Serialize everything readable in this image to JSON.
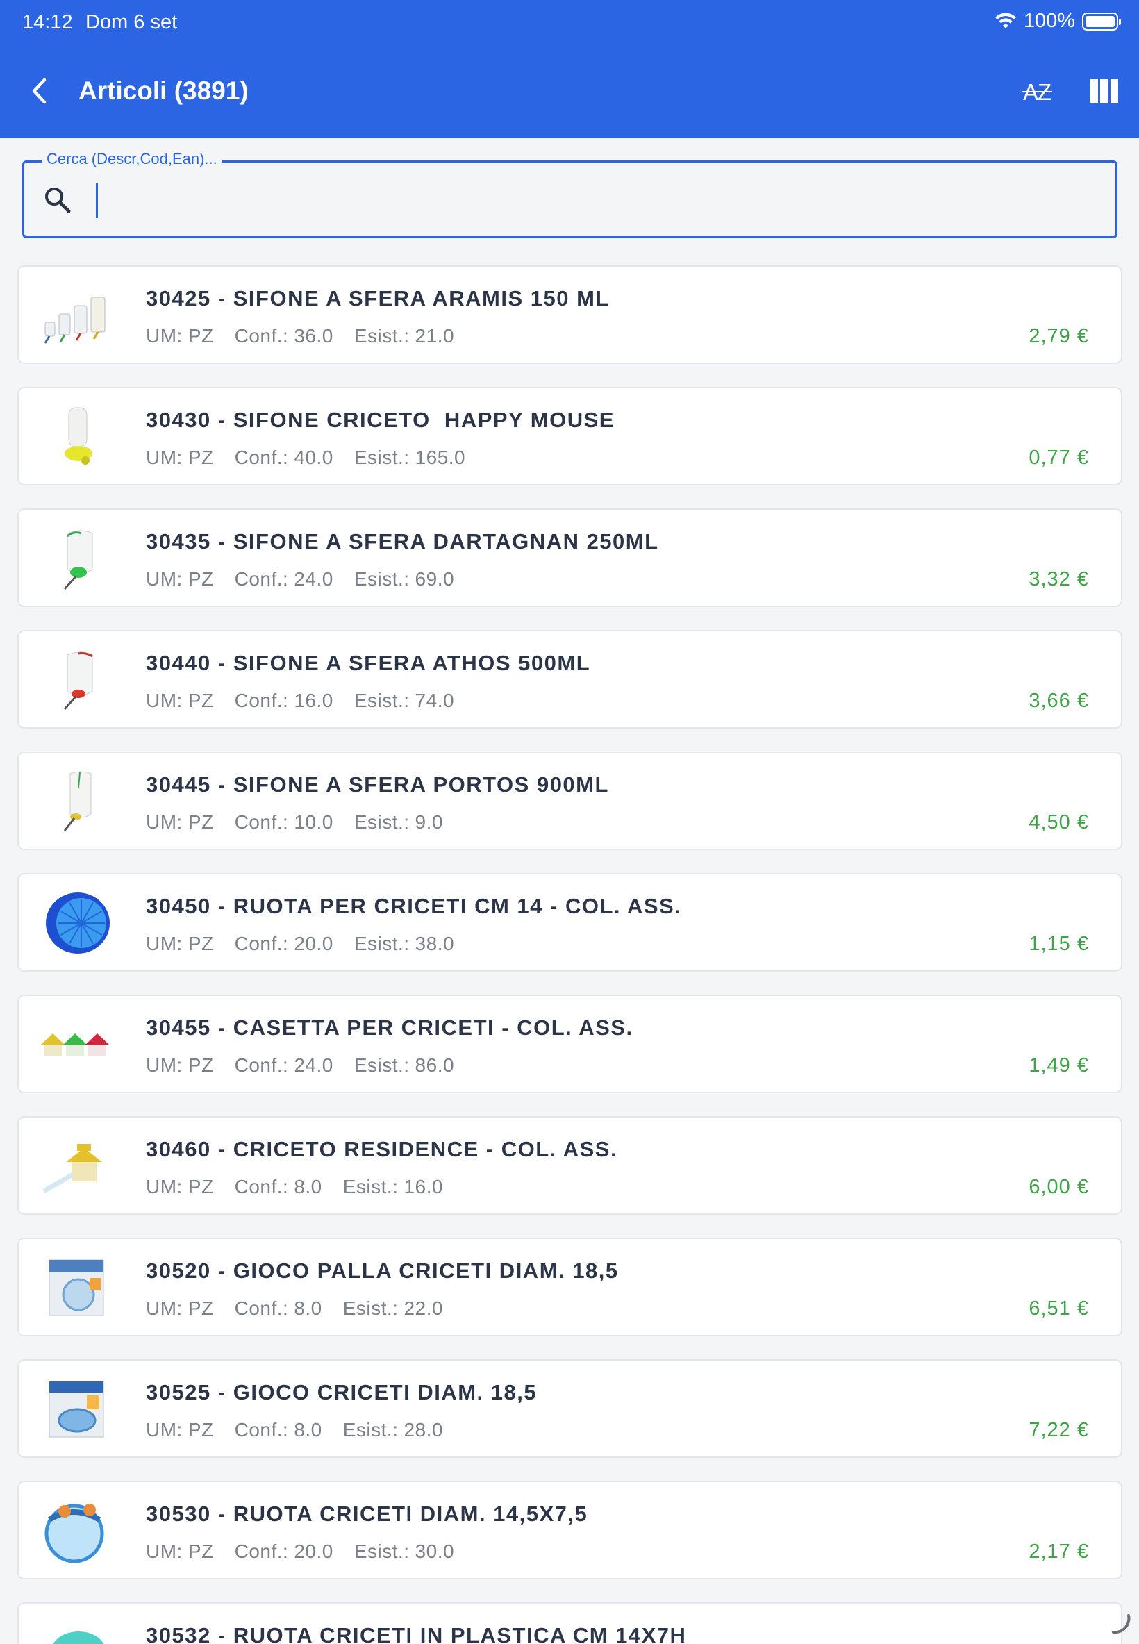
{
  "status": {
    "time": "14:12",
    "date": "Dom 6 set",
    "battery": "100%"
  },
  "header": {
    "title": "Articoli (3891)",
    "sort_label": "AZ"
  },
  "search": {
    "label": "Cerca (Descr,Cod,Ean)...",
    "value": ""
  },
  "meta_labels": {
    "um": "UM:",
    "conf": "Conf.:",
    "esist": "Esist.:"
  },
  "items": [
    {
      "title": "30425 - SIFONE A SFERA ARAMIS 150 ML",
      "um": "PZ",
      "conf": "36.0",
      "esist": "21.0",
      "price": "2,79 €",
      "thumb": "bottles-set-icon"
    },
    {
      "title": "30430 - SIFONE CRICETO  HAPPY MOUSE",
      "um": "PZ",
      "conf": "40.0",
      "esist": "165.0",
      "price": "0,77 €",
      "thumb": "yellow-bottle-icon"
    },
    {
      "title": "30435 - SIFONE A SFERA DARTAGNAN 250ML",
      "um": "PZ",
      "conf": "24.0",
      "esist": "69.0",
      "price": "3,32 €",
      "thumb": "green-bottle-icon"
    },
    {
      "title": "30440 - SIFONE A SFERA ATHOS 500ML",
      "um": "PZ",
      "conf": "16.0",
      "esist": "74.0",
      "price": "3,66 €",
      "thumb": "red-bottle-icon"
    },
    {
      "title": "30445 - SIFONE A SFERA PORTOS 900ML",
      "um": "PZ",
      "conf": "10.0",
      "esist": "9.0",
      "price": "4,50 €",
      "thumb": "yellow-tip-bottle-icon"
    },
    {
      "title": "30450 - RUOTA PER CRICETI CM 14 - COL. ASS.",
      "um": "PZ",
      "conf": "20.0",
      "esist": "38.0",
      "price": "1,15 €",
      "thumb": "blue-wheel-icon"
    },
    {
      "title": "30455 - CASETTA PER CRICETI - COL. ASS.",
      "um": "PZ",
      "conf": "24.0",
      "esist": "86.0",
      "price": "1,49 €",
      "thumb": "houses-icon"
    },
    {
      "title": "30460 - CRICETO RESIDENCE - COL. ASS.",
      "um": "PZ",
      "conf": "8.0",
      "esist": "16.0",
      "price": "6,00 €",
      "thumb": "residence-icon"
    },
    {
      "title": "30520 - GIOCO PALLA CRICETI DIAM. 18,5",
      "um": "PZ",
      "conf": "8.0",
      "esist": "22.0",
      "price": "6,51 €",
      "thumb": "ball-box-icon"
    },
    {
      "title": "30525 - GIOCO CRICETI DIAM. 18,5",
      "um": "PZ",
      "conf": "8.0",
      "esist": "28.0",
      "price": "7,22 €",
      "thumb": "game-box-icon"
    },
    {
      "title": "30530 - RUOTA CRICETI DIAM. 14,5X7,5",
      "um": "PZ",
      "conf": "20.0",
      "esist": "30.0",
      "price": "2,17 €",
      "thumb": "twistering-wheel-icon"
    },
    {
      "title": "30532 - RUOTA CRICETI IN PLASTICA CM 14X7H",
      "thumb": "partial-wheel-icon"
    }
  ]
}
